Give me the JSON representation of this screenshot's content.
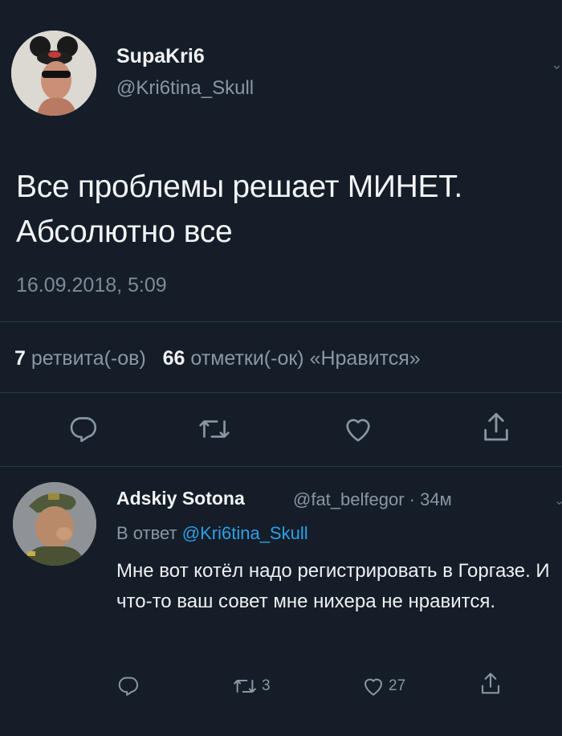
{
  "tweet": {
    "author_name": "SupaKri6",
    "author_handle": "@Kri6tina_Skull",
    "text": "Все проблемы решает МИНЕТ. Абсолютно все",
    "timestamp": "16.09.2018, 5:09",
    "retweets": "7",
    "retweets_label": "ретвита(-ов)",
    "likes": "66",
    "likes_label": "отметки(-ок) «Нравится»"
  },
  "reply": {
    "author_name": "Adskiy Sotona",
    "author_handle": "@fat_belfegor",
    "time": "34м",
    "reply_to_label": "В ответ",
    "reply_to_handle": "@Kri6tina_Skull",
    "text": "Мне вот котёл надо регистрировать в Горгазе. И что-то ваш совет мне нихера не нравится.",
    "retweet_count": "3",
    "like_count": "27"
  },
  "colors": {
    "background": "#151d28",
    "link": "#2d9fe8",
    "secondary_text": "#8a96a3"
  },
  "icons": [
    "reply-icon",
    "retweet-icon",
    "like-icon",
    "share-icon"
  ]
}
